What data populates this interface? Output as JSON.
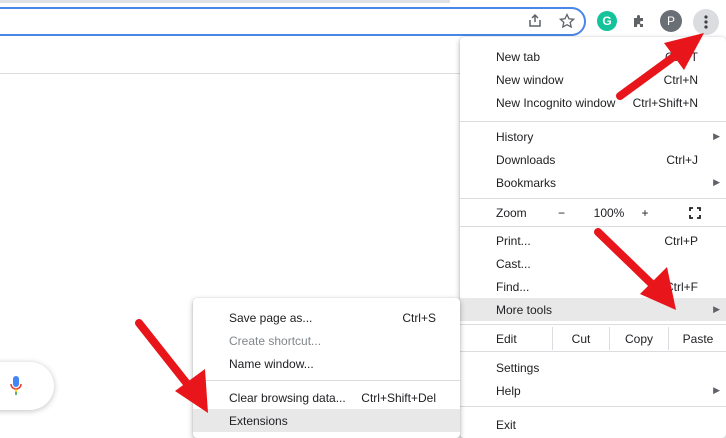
{
  "toolbar": {
    "share_icon": "share-icon",
    "bookmark_icon": "star-icon",
    "grammarly_letter": "G",
    "extensions_icon": "puzzle-icon",
    "profile_initial": "P",
    "menu_icon": "kebab-icon"
  },
  "main_menu": {
    "new_tab": {
      "label": "New tab",
      "accel": "Ctrl+T"
    },
    "new_window": {
      "label": "New window",
      "accel": "Ctrl+N"
    },
    "new_incognito": {
      "label": "New Incognito window",
      "accel": "Ctrl+Shift+N"
    },
    "history": {
      "label": "History"
    },
    "downloads": {
      "label": "Downloads",
      "accel": "Ctrl+J"
    },
    "bookmarks": {
      "label": "Bookmarks"
    },
    "zoom": {
      "label": "Zoom",
      "minus": "−",
      "value": "100%",
      "plus": "+"
    },
    "print": {
      "label": "Print...",
      "accel": "Ctrl+P"
    },
    "cast": {
      "label": "Cast..."
    },
    "find": {
      "label": "Find...",
      "accel": "Ctrl+F"
    },
    "more_tools": {
      "label": "More tools"
    },
    "edit": {
      "label": "Edit",
      "cut": "Cut",
      "copy": "Copy",
      "paste": "Paste"
    },
    "settings": {
      "label": "Settings"
    },
    "help": {
      "label": "Help"
    },
    "exit": {
      "label": "Exit"
    }
  },
  "submenu": {
    "save_page": {
      "label": "Save page as...",
      "accel": "Ctrl+S"
    },
    "create_shortcut": {
      "label": "Create shortcut..."
    },
    "name_window": {
      "label": "Name window..."
    },
    "clear_browsing": {
      "label": "Clear browsing data...",
      "accel": "Ctrl+Shift+Del"
    },
    "extensions": {
      "label": "Extensions"
    }
  },
  "colors": {
    "annotation_arrow": "#e8151b",
    "highlight": "#e8e8e8",
    "omnibox_border": "#4a86e8"
  }
}
